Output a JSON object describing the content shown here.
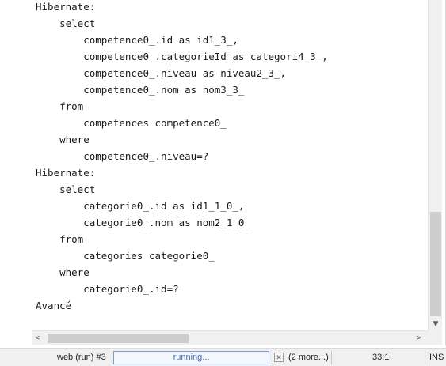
{
  "output": {
    "lines": [
      "Hibernate:",
      "    select",
      "        competence0_.id as id1_3_,",
      "        competence0_.categorieId as categori4_3_,",
      "        competence0_.niveau as niveau2_3_,",
      "        competence0_.nom as nom3_3_",
      "    from",
      "        competences competence0_",
      "    where",
      "        competence0_.niveau=?",
      "Hibernate:",
      "    select",
      "        categorie0_.id as id1_1_0_,",
      "        categorie0_.nom as nom2_1_0_",
      "    from",
      "        categories categorie0_",
      "    where",
      "        categorie0_.id=?",
      "Avancé"
    ]
  },
  "scrollbars": {
    "up_icon": "▲",
    "down_icon": "▼",
    "left_icon": "<",
    "right_icon": ">"
  },
  "status": {
    "task_name": "web (run) #3",
    "progress_text": "running...",
    "cancel_icon": "✕",
    "more_tasks": "(2 more...)",
    "caret_position": "33:1",
    "insert_mode": "INS"
  }
}
